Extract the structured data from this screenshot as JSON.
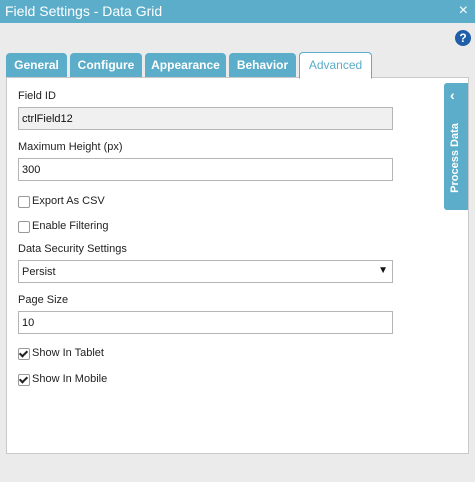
{
  "window": {
    "title": "Field Settings - Data Grid",
    "close_glyph": "×"
  },
  "help": {
    "glyph": "?"
  },
  "tabs": [
    {
      "label": "General"
    },
    {
      "label": "Configure"
    },
    {
      "label": "Appearance"
    },
    {
      "label": "Behavior"
    },
    {
      "label": "Advanced",
      "active": true
    }
  ],
  "form": {
    "field_id_label": "Field ID",
    "field_id_value": "ctrlField12",
    "max_height_label": "Maximum Height (px)",
    "max_height_value": "300",
    "export_csv_label": "Export As CSV",
    "export_csv_checked": false,
    "enable_filtering_label": "Enable Filtering",
    "enable_filtering_checked": false,
    "data_security_label": "Data Security Settings",
    "data_security_value": "Persist",
    "page_size_label": "Page Size",
    "page_size_value": "10",
    "show_tablet_label": "Show In Tablet",
    "show_tablet_checked": true,
    "show_mobile_label": "Show In Mobile",
    "show_mobile_checked": true
  },
  "side_panel": {
    "label": "Process Data",
    "chevron": "‹"
  },
  "colors": {
    "accent": "#5badc9",
    "help": "#1f5ea8"
  }
}
